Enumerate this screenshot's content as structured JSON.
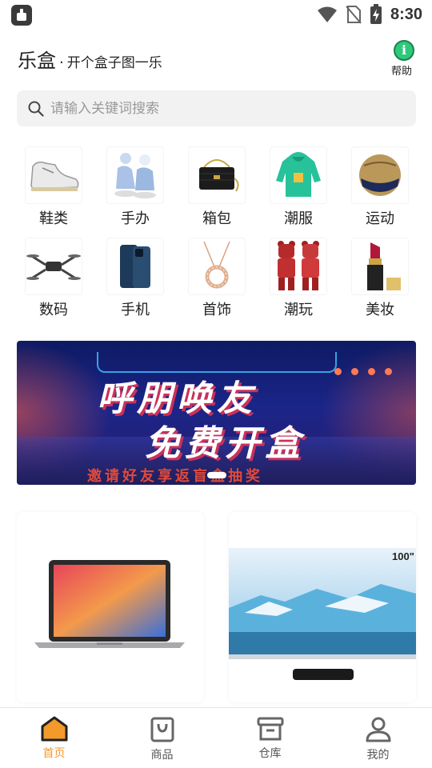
{
  "status_bar": {
    "time": "8:30",
    "icons": [
      "app-notification-icon",
      "wifi-icon",
      "no-sim-icon",
      "battery-charging-icon"
    ]
  },
  "header": {
    "brand": "乐盒",
    "separator": "·",
    "slogan": "开个盒子图一乐",
    "help_label": "帮助",
    "help_icon_glyph": "i"
  },
  "search": {
    "placeholder": "请输入关键词搜索"
  },
  "categories": [
    {
      "label": "鞋类",
      "icon": "sneaker-icon"
    },
    {
      "label": "手办",
      "icon": "figurine-icon"
    },
    {
      "label": "箱包",
      "icon": "handbag-icon"
    },
    {
      "label": "潮服",
      "icon": "hoodie-icon"
    },
    {
      "label": "运动",
      "icon": "ball-icon"
    },
    {
      "label": "数码",
      "icon": "drone-icon"
    },
    {
      "label": "手机",
      "icon": "phone-icon"
    },
    {
      "label": "首饰",
      "icon": "necklace-icon"
    },
    {
      "label": "潮玩",
      "icon": "bearbrick-icon"
    },
    {
      "label": "美妆",
      "icon": "lipstick-icon"
    }
  ],
  "banner": {
    "line1": "呼朋唤友",
    "line2": "免费开盒",
    "subtitle": "邀请好友享返盲盒抽奖",
    "slide_count": 3,
    "active_slide": 1
  },
  "products": [
    {
      "name": "laptop",
      "image": "laptop-image"
    },
    {
      "name": "projector",
      "image": "projector-image",
      "badge": "100\""
    }
  ],
  "bottom_nav": [
    {
      "label": "首页",
      "icon": "home-icon",
      "active": true
    },
    {
      "label": "商品",
      "icon": "shopping-bag-icon",
      "active": false
    },
    {
      "label": "仓库",
      "icon": "warehouse-box-icon",
      "active": false
    },
    {
      "label": "我的",
      "icon": "user-icon",
      "active": false
    }
  ],
  "colors": {
    "accent": "#f39a2b",
    "banner_bg": "#1a2588",
    "search_bg": "#f2f2f2"
  }
}
